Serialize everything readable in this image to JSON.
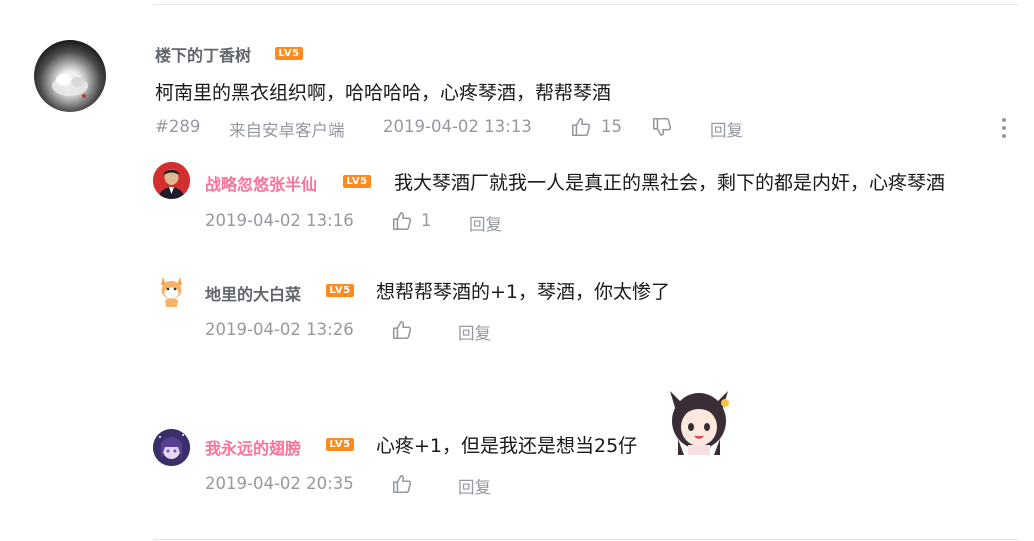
{
  "comment": {
    "username": "楼下的丁香树",
    "level": "LV5",
    "content": "柯南里的黑衣组织啊，哈哈哈哈，心疼琴酒，帮帮琴酒",
    "floor": "#289",
    "source": "来自安卓客户端",
    "time": "2019-04-02 13:13",
    "likes": "15",
    "reply_label": "回复"
  },
  "replies": [
    {
      "username": "战略忽悠张半仙",
      "level": "LV5",
      "content": "我大琴酒厂就我一人是真正的黑社会，剩下的都是内奸，心疼琴酒",
      "time": "2019-04-02 13:16",
      "likes": "1",
      "reply_label": "回复"
    },
    {
      "username": "地里的大白菜",
      "level": "LV5",
      "content": "想帮帮琴酒的+1，琴酒，你太惨了",
      "time": "2019-04-02 13:26",
      "likes": "",
      "reply_label": "回复"
    },
    {
      "username": "我永远的翅膀",
      "level": "LV5",
      "content": "心疼+1，但是我还是想当25仔",
      "time": "2019-04-02 20:35",
      "likes": "",
      "reply_label": "回复"
    }
  ],
  "colors": {
    "vip_name": "#fb7299",
    "normal_name": "#61666d",
    "level_badge": "#ff8a1f",
    "meta_text": "#9499a0"
  }
}
